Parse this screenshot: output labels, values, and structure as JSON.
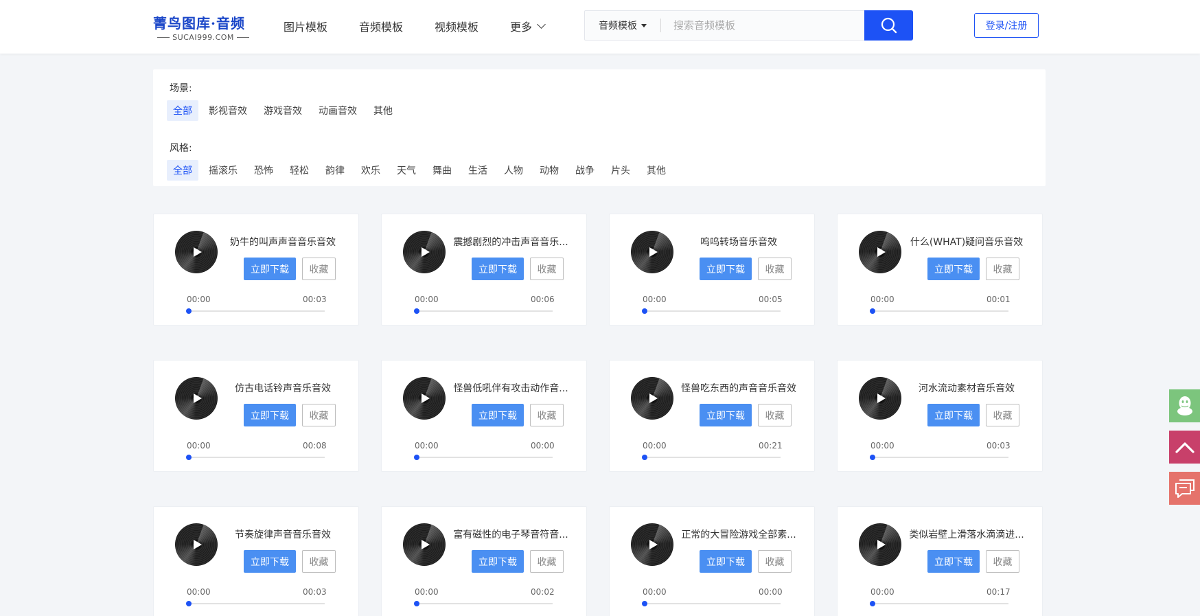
{
  "header": {
    "logo_title": "菁鸟图库·音频",
    "logo_sub": "SUCAI999.COM",
    "nav": [
      "图片模板",
      "音频模板",
      "视频模板",
      "更多"
    ],
    "search_type": "音频模板",
    "search_placeholder": "搜索音频模板",
    "login_label": "登录/注册"
  },
  "filters": {
    "scene_label": "场景:",
    "scene_tags": [
      "全部",
      "影视音效",
      "游戏音效",
      "动画音效",
      "其他"
    ],
    "style_label": "风格:",
    "style_tags": [
      "全部",
      "摇滚乐",
      "恐怖",
      "轻松",
      "韵律",
      "欢乐",
      "天气",
      "舞曲",
      "生活",
      "人物",
      "动物",
      "战争",
      "片头",
      "其他"
    ]
  },
  "card_labels": {
    "download": "立即下载",
    "favorite": "收藏"
  },
  "cards": [
    {
      "title": "奶牛的叫声声音音乐音效",
      "start": "00:00",
      "end": "00:03"
    },
    {
      "title": "震撼剧烈的冲击声音音乐...",
      "start": "00:00",
      "end": "00:06"
    },
    {
      "title": "呜呜转场音乐音效",
      "start": "00:00",
      "end": "00:05"
    },
    {
      "title": "什么(WHAT)疑问音乐音效",
      "start": "00:00",
      "end": "00:01"
    },
    {
      "title": "仿古电话铃声音乐音效",
      "start": "00:00",
      "end": "00:08"
    },
    {
      "title": "怪兽低吼伴有攻击动作音...",
      "start": "00:00",
      "end": "00:00"
    },
    {
      "title": "怪兽吃东西的声音音乐音效",
      "start": "00:00",
      "end": "00:21"
    },
    {
      "title": "河水流动素材音乐音效",
      "start": "00:00",
      "end": "00:03"
    },
    {
      "title": "节奏旋律声音音乐音效",
      "start": "00:00",
      "end": "00:03"
    },
    {
      "title": "富有磁性的电子琴音符音...",
      "start": "00:00",
      "end": "00:02"
    },
    {
      "title": "正常的大冒险游戏全部素...",
      "start": "00:00",
      "end": "00:00"
    },
    {
      "title": "类似岩壁上滑落水滴滴进...",
      "start": "00:00",
      "end": "00:17"
    }
  ]
}
